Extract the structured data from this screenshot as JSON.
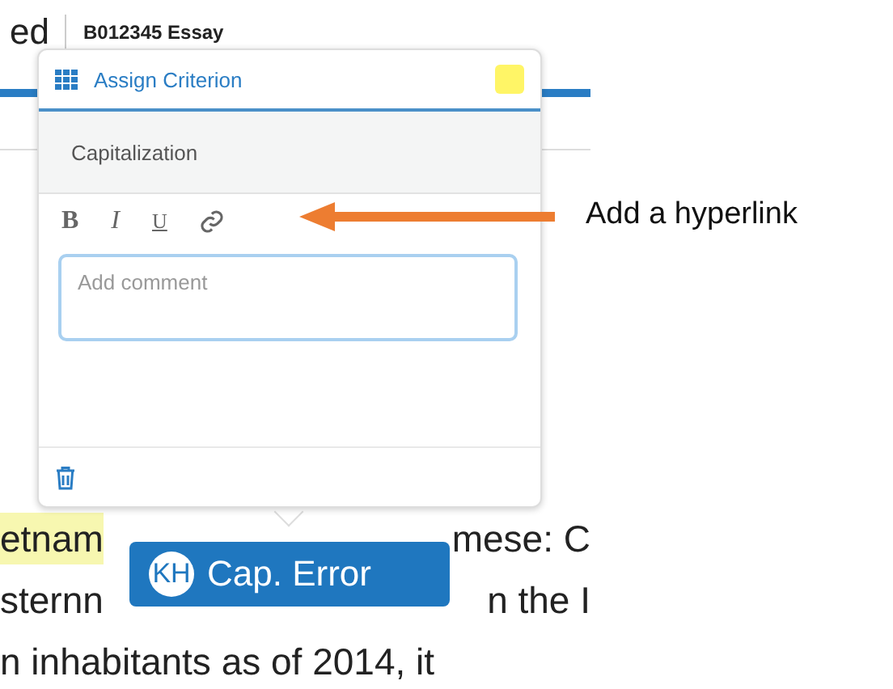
{
  "header": {
    "title_fragment": "ed",
    "document": "B012345 Essay"
  },
  "popup": {
    "title": "Assign Criterion",
    "color": "#fff566",
    "criterion": "Capitalization",
    "toolbar": [
      {
        "kind": "bold",
        "label": "B"
      },
      {
        "kind": "italic",
        "label": "I"
      },
      {
        "kind": "underline",
        "label": "U"
      },
      {
        "kind": "link"
      }
    ],
    "comment": {
      "placeholder": "Add comment"
    }
  },
  "document_lines": [
    [
      {
        "text": "etnam",
        "highlighted": true
      },
      {
        "text": "mese: C",
        "highlighted": false
      }
    ],
    [
      {
        "text": "sternn",
        "highlighted": false
      },
      {
        "text": "n the I",
        "highlighted": false
      }
    ],
    [
      {
        "text": "n inhabitants as of 2014, it",
        "highlighted": false
      }
    ]
  ],
  "tag": {
    "initials": "KH",
    "label": "Cap. Error"
  },
  "callout": {
    "text": "Add a hyperlink"
  }
}
